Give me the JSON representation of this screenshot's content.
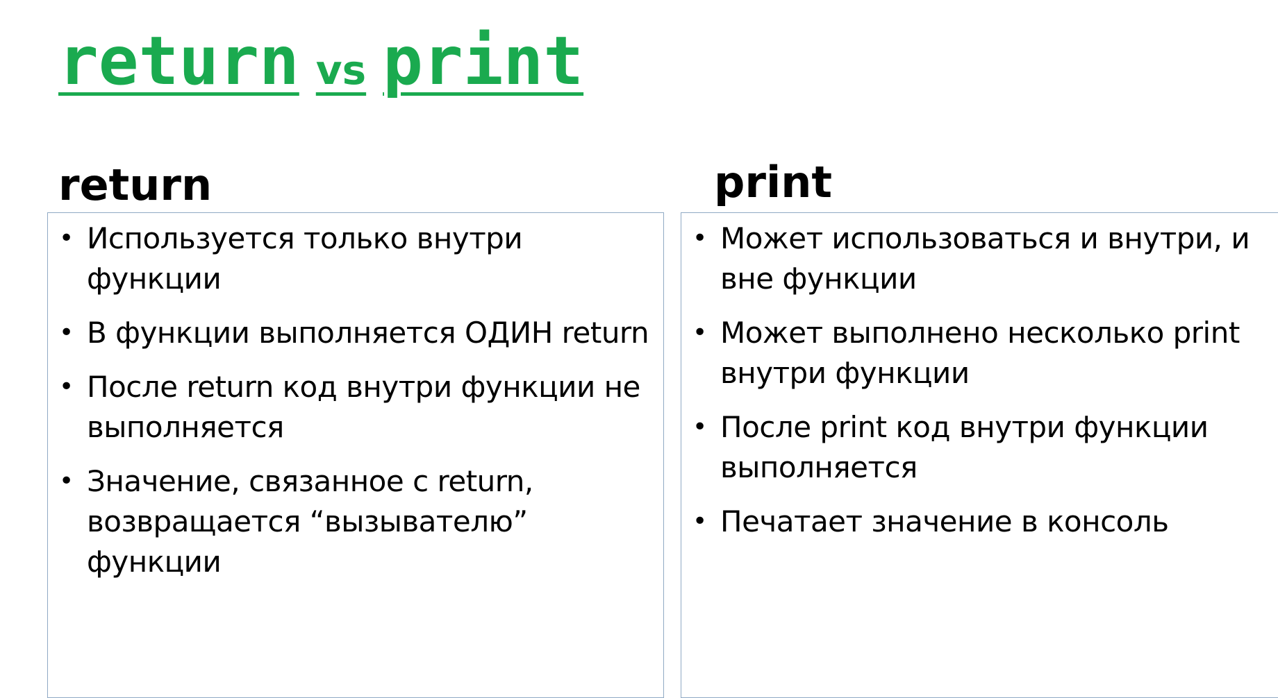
{
  "slide": {
    "title": {
      "word1": "return",
      "connector": "vs",
      "word2": "print",
      "color": "#1aaa4f"
    },
    "columns": [
      {
        "heading": "return",
        "points": [
          "Используется только внутри функции",
          "В функции выполняется ОДИН return",
          "После return код внутри функции не выполняется",
          "Значение, связанное с return, возвращается “вызывателю” функции"
        ]
      },
      {
        "heading": "print",
        "points": [
          "Может использоваться и внутри, и вне функции",
          "Может выполнено несколько print внутри функции",
          "После print код внутри функции выполняется",
          "Печатает значение в консоль"
        ]
      }
    ],
    "bullet_glyph": "•",
    "box_border_color": "#8fa9c4"
  }
}
